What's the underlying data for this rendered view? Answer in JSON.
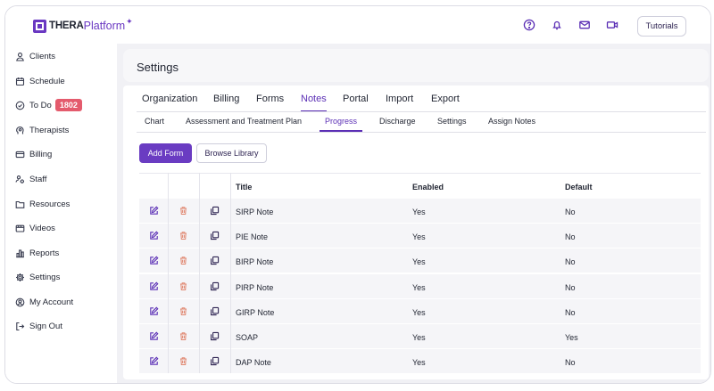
{
  "app": {
    "logo_thera": "THERA",
    "logo_platform": "Platform",
    "tutorials_label": "Tutorials"
  },
  "topbar_icons": [
    "help-icon",
    "bell-icon",
    "mail-icon",
    "video-icon"
  ],
  "sidebar": {
    "items": [
      {
        "label": "Clients",
        "icon": "clients-icon"
      },
      {
        "label": "Schedule",
        "icon": "calendar-icon"
      },
      {
        "label": "To Do",
        "icon": "check-circle-icon",
        "badge": "1802"
      },
      {
        "label": "Therapists",
        "icon": "therapist-icon"
      },
      {
        "label": "Billing",
        "icon": "billing-icon"
      },
      {
        "label": "Staff",
        "icon": "staff-icon"
      },
      {
        "label": "Resources",
        "icon": "folder-icon"
      },
      {
        "label": "Videos",
        "icon": "video-icon"
      },
      {
        "label": "Reports",
        "icon": "reports-icon"
      },
      {
        "label": "Settings",
        "icon": "gear-icon"
      },
      {
        "label": "My Account",
        "icon": "account-icon"
      },
      {
        "label": "Sign Out",
        "icon": "sign-out-icon"
      }
    ]
  },
  "page": {
    "title": "Settings"
  },
  "tabs": {
    "primary": [
      "Organization",
      "Billing",
      "Forms",
      "Notes",
      "Portal",
      "Import",
      "Export"
    ],
    "primary_active": "Notes",
    "secondary": [
      "Chart",
      "Assessment and Treatment Plan",
      "Progress",
      "Discharge",
      "Settings",
      "Assign Notes"
    ],
    "secondary_active": "Progress"
  },
  "buttons": {
    "add_form": "Add Form",
    "browse_library": "Browse Library"
  },
  "table": {
    "headers": {
      "title": "Title",
      "enabled": "Enabled",
      "default": "Default"
    },
    "rows": [
      {
        "title": "SIRP Note",
        "enabled": "Yes",
        "default": "No"
      },
      {
        "title": "PIE Note",
        "enabled": "Yes",
        "default": "No"
      },
      {
        "title": "BIRP Note",
        "enabled": "Yes",
        "default": "No"
      },
      {
        "title": "PIRP Note",
        "enabled": "Yes",
        "default": "No"
      },
      {
        "title": "GIRP Note",
        "enabled": "Yes",
        "default": "No"
      },
      {
        "title": "SOAP",
        "enabled": "Yes",
        "default": "Yes"
      },
      {
        "title": "DAP Note",
        "enabled": "Yes",
        "default": "No"
      }
    ]
  },
  "colors": {
    "accent": "#5b2fb5",
    "badge": "#e45b6d",
    "delete_icon": "#e0866f"
  }
}
